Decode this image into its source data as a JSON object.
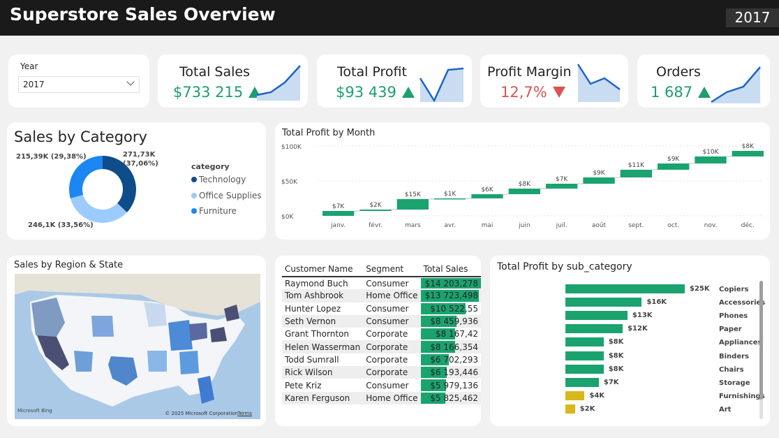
{
  "header": {
    "title": "Superstore Sales Overview",
    "year_badge": "2017"
  },
  "slicer": {
    "label": "Year",
    "value": "2017"
  },
  "kpis": [
    {
      "label": "Total Sales",
      "value": "$733 215",
      "trend": "up",
      "color": "#1e9e6c"
    },
    {
      "label": "Total Profit",
      "value": "$93 439",
      "trend": "up",
      "color": "#1e9e6c"
    },
    {
      "label": "Profit Margin",
      "value": "12,7%",
      "trend": "down",
      "color": "#d9534f"
    },
    {
      "label": "Orders",
      "value": "1 687",
      "trend": "up",
      "color": "#1e9e6c"
    }
  ],
  "category": {
    "title": "Sales by Category",
    "legend_title": "category",
    "items": [
      {
        "name": "Technology",
        "label": "271,73K (37,06%)",
        "share": 37.06,
        "color": "#0f4c8a"
      },
      {
        "name": "Office Supplies",
        "label": "246,1K (33,56%)",
        "share": 33.56,
        "color": "#9ccbff"
      },
      {
        "name": "Furniture",
        "label": "215,39K (29,38%)",
        "share": 29.38,
        "color": "#1c86f2"
      }
    ]
  },
  "chart_data": {
    "type": "bar",
    "title": "Total Profit by Month",
    "categories": [
      "janv.",
      "févr.",
      "mars",
      "avr.",
      "mai",
      "juin",
      "juil.",
      "août",
      "sept.",
      "oct.",
      "nov.",
      "déc."
    ],
    "values": [
      7,
      2,
      15,
      1,
      6,
      8,
      7,
      9,
      11,
      9,
      10,
      8
    ],
    "data_labels": [
      "$7K",
      "$2K",
      "$15K",
      "$1K",
      "$6K",
      "$8K",
      "$7K",
      "$9K",
      "$11K",
      "$9K",
      "$10K",
      "$8K"
    ],
    "y_ticks": [
      "$100K",
      "$50K",
      "$0K"
    ],
    "ylim": [
      0,
      100
    ],
    "cumulative": true,
    "color": "#1aa36f"
  },
  "map": {
    "title": "Sales by Region & State",
    "credit_left": "Microsoft Bing",
    "credit_right": "© 2025 Microsoft Corporation",
    "terms": "Terms"
  },
  "customers": {
    "columns": [
      "Customer Name",
      "Segment",
      "Total Sales"
    ],
    "rows": [
      {
        "name": "Raymond Buch",
        "segment": "Consumer",
        "sales": "$14 203,278",
        "amount": 14203.278
      },
      {
        "name": "Tom Ashbrook",
        "segment": "Home Office",
        "sales": "$13 723,498",
        "amount": 13723.498
      },
      {
        "name": "Hunter Lopez",
        "segment": "Consumer",
        "sales": "$10 522,55",
        "amount": 10522.55
      },
      {
        "name": "Seth Vernon",
        "segment": "Consumer",
        "sales": "$8 459,936",
        "amount": 8459.936
      },
      {
        "name": "Grant Thornton",
        "segment": "Corporate",
        "sales": "$8 167,42",
        "amount": 8167.42
      },
      {
        "name": "Helen Wasserman",
        "segment": "Corporate",
        "sales": "$8 166,354",
        "amount": 8166.354
      },
      {
        "name": "Todd Sumrall",
        "segment": "Corporate",
        "sales": "$6 702,293",
        "amount": 6702.293
      },
      {
        "name": "Rick Wilson",
        "segment": "Corporate",
        "sales": "$6 193,446",
        "amount": 6193.446
      },
      {
        "name": "Pete Kriz",
        "segment": "Consumer",
        "sales": "$5 979,136",
        "amount": 5979.136
      },
      {
        "name": "Karen Ferguson",
        "segment": "Home Office",
        "sales": "$5 825,462",
        "amount": 5825.462
      }
    ]
  },
  "subcategory": {
    "title": "Total Profit by sub_category",
    "items": [
      {
        "name": "Copiers",
        "value": 25,
        "label": "$25K",
        "color": "#1aa36f"
      },
      {
        "name": "Accessories",
        "value": 16,
        "label": "$16K",
        "color": "#1aa36f"
      },
      {
        "name": "Phones",
        "value": 13,
        "label": "$13K",
        "color": "#1aa36f"
      },
      {
        "name": "Paper",
        "value": 12,
        "label": "$12K",
        "color": "#1aa36f"
      },
      {
        "name": "Appliances",
        "value": 8,
        "label": "$8K",
        "color": "#1aa36f"
      },
      {
        "name": "Binders",
        "value": 8,
        "label": "$8K",
        "color": "#1aa36f"
      },
      {
        "name": "Chairs",
        "value": 8,
        "label": "$8K",
        "color": "#1aa36f"
      },
      {
        "name": "Storage",
        "value": 7,
        "label": "$7K",
        "color": "#1aa36f"
      },
      {
        "name": "Furnishings",
        "value": 4,
        "label": "$4K",
        "color": "#d9b81a"
      },
      {
        "name": "Art",
        "value": 2,
        "label": "$2K",
        "color": "#d9b81a"
      }
    ]
  }
}
